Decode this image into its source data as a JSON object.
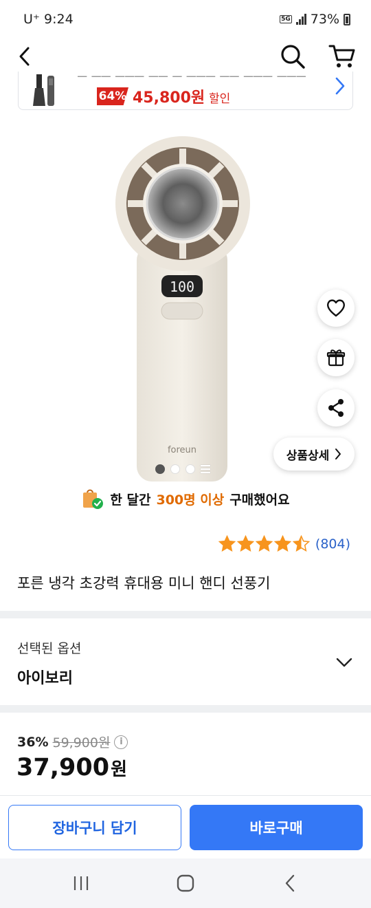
{
  "status_bar": {
    "carrier": "U⁺",
    "time": "9:24",
    "network": "5G",
    "battery": "73%"
  },
  "promo": {
    "discount": "64%",
    "price": "45,800원",
    "sale_label": "할인"
  },
  "product": {
    "purchase_prefix": "한 달간",
    "purchase_highlight": "300명 이상",
    "purchase_suffix": "구매했어요",
    "rating_value": 4.5,
    "rating_count": "(804)",
    "title": "포른 냉각 초강력 휴대용 미니 핸디 선풍기",
    "image_display": "100",
    "image_brand": "foreun",
    "image_dots_total": 4,
    "image_dot_active": 1
  },
  "side_actions": {
    "detail_label": "상품상세"
  },
  "option": {
    "label": "선택된 옵션",
    "value": "아이보리"
  },
  "price": {
    "discount": "36%",
    "original": "59,900원",
    "final": "37,900",
    "unit": "원"
  },
  "bottom_bar": {
    "cart_label": "장바구니 담기",
    "buy_label": "바로구매"
  },
  "colors": {
    "accent_blue": "#3478f6",
    "sale_red": "#d9251d",
    "highlight_orange": "#e06a00",
    "star_orange": "#f7941d"
  }
}
